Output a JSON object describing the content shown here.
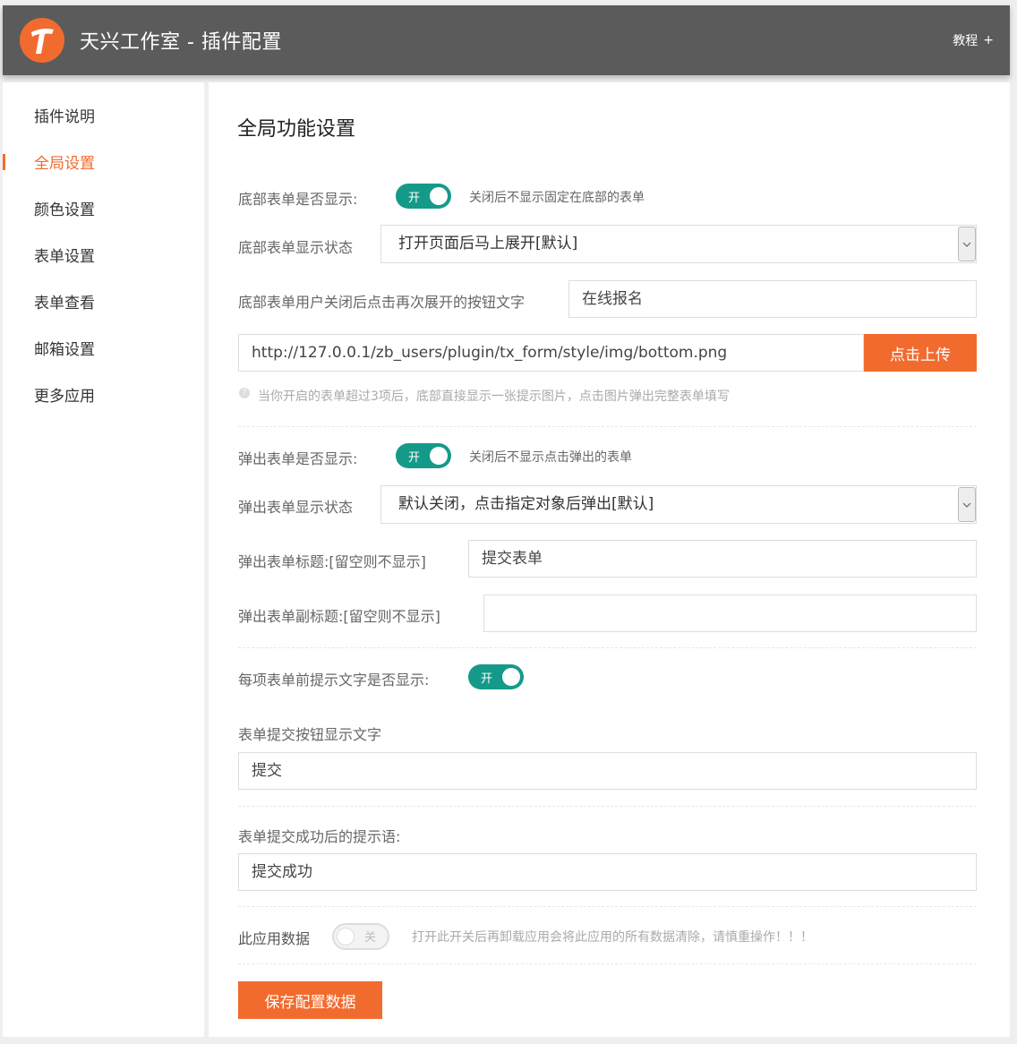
{
  "header": {
    "title": "天兴工作室 - 插件配置",
    "tutorial_label": "教程",
    "tutorial_icon": "plus-icon"
  },
  "sidebar": {
    "items": [
      {
        "label": "插件说明",
        "active": false
      },
      {
        "label": "全局设置",
        "active": true
      },
      {
        "label": "颜色设置",
        "active": false
      },
      {
        "label": "表单设置",
        "active": false
      },
      {
        "label": "表单查看",
        "active": false
      },
      {
        "label": "邮箱设置",
        "active": false
      },
      {
        "label": "更多应用",
        "active": false
      }
    ]
  },
  "main": {
    "title": "全局功能设置",
    "bottom_form": {
      "show_label": "底部表单是否显示:",
      "show_toggle": "开",
      "show_hint": "关闭后不显示固定在底部的表单",
      "state_label": "底部表单显示状态",
      "state_value": "打开页面后马上展开[默认]",
      "reopen_label": "底部表单用户关闭后点击再次展开的按钮文字",
      "reopen_value": "在线报名",
      "image_url": "http://127.0.0.1/zb_users/plugin/tx_form/style/img/bottom.png",
      "upload_button": "点击上传",
      "image_hint": "当你开启的表单超过3项后，底部直接显示一张提示图片，点击图片弹出完整表单填写"
    },
    "popup_form": {
      "show_label": "弹出表单是否显示:",
      "show_toggle": "开",
      "show_hint": "关闭后不显示点击弹出的表单",
      "state_label": "弹出表单显示状态",
      "state_value": "默认关闭，点击指定对象后弹出[默认]",
      "title_label": "弹出表单标题:[留空则不显示]",
      "title_value": "提交表单",
      "subtitle_label": "弹出表单副标题:[留空则不显示]",
      "subtitle_value": ""
    },
    "prompt": {
      "label": "每项表单前提示文字是否显示:",
      "toggle": "开"
    },
    "submit": {
      "label": "表单提交按钮显示文字",
      "value": "提交"
    },
    "success": {
      "label": "表单提交成功后的提示语:",
      "value": "提交成功"
    },
    "app_data": {
      "label": "此应用数据",
      "toggle": "关",
      "hint": "打开此开关后再卸载应用会将此应用的所有数据清除，请慎重操作！！！"
    },
    "save_button": "保存配置数据"
  },
  "colors": {
    "accent": "#f26b2e",
    "toggle_on": "#159a8a",
    "header_bg": "#5b5b5b"
  }
}
